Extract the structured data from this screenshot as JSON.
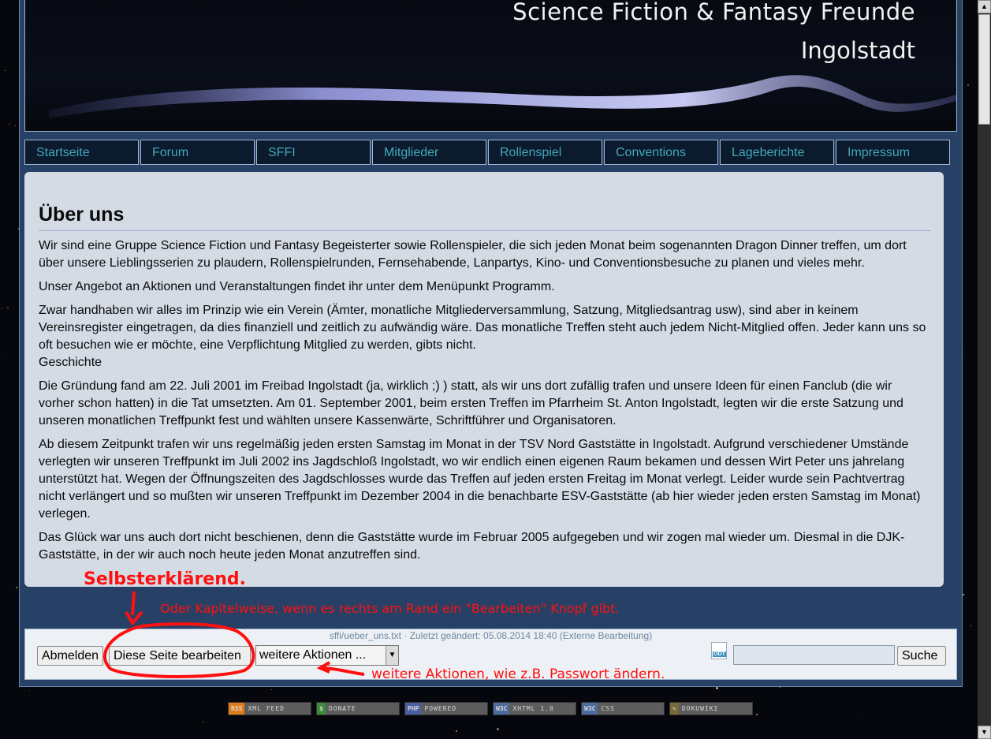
{
  "header": {
    "title_line1": "Science Fiction & Fantasy Freunde",
    "title_line2": "Ingolstadt"
  },
  "nav": {
    "items": [
      "Startseite",
      "Forum",
      "SFFI",
      "Mitglieder",
      "Rollenspiel",
      "Conventions",
      "Lageberichte",
      "Impressum"
    ]
  },
  "content": {
    "title": "Über uns",
    "p1": "Wir sind eine Gruppe Science Fiction und Fantasy Begeisterter sowie Rollenspieler, die sich jeden Monat beim sogenannten Dragon Dinner treffen, um dort über unsere Lieblingsserien zu plaudern, Rollenspielrunden, Fernsehabende, Lanpartys, Kino- und Conventionsbesuche zu planen und vieles mehr.",
    "p2": "Unser Angebot an Aktionen und Veranstaltungen findet ihr unter dem Menüpunkt Programm.",
    "p3": "Zwar handhaben wir alles im Prinzip wie ein Verein (Ämter, monatliche Mitgliederversammlung, Satzung, Mitgliedsantrag usw), sind aber in keinem Vereinsregister eingetragen, da dies finanziell und zeitlich zu aufwändig wäre. Das monatliche Treffen steht auch jedem Nicht-Mitglied offen. Jeder kann uns so oft besuchen wie er möchte, eine Verpflichtung Mitglied zu werden, gibts nicht.",
    "heading2": "Geschichte",
    "p4": "Die Gründung fand am 22. Juli 2001 im Freibad Ingolstadt (ja, wirklich ;) ) statt, als wir uns dort zufällig trafen und unsere Ideen für einen Fanclub (die wir vorher schon hatten) in die Tat umsetzten. Am 01. September 2001, beim ersten Treffen im Pfarrheim St. Anton Ingolstadt, legten wir die erste Satzung und unseren monatlichen Treffpunkt fest und wählten unsere Kassenwärte, Schriftführer und Organisatoren.",
    "p5": "Ab diesem Zeitpunkt trafen wir uns regelmäßig jeden ersten Samstag im Monat in der TSV Nord Gaststätte in Ingolstadt. Aufgrund verschiedener Umstände verlegten wir unseren Treffpunkt im Juli 2002 ins Jagdschloß Ingolstadt, wo wir endlich einen eigenen Raum bekamen und dessen Wirt Peter uns jahrelang unterstützt hat. Wegen der Öffnungszeiten des Jagdschlosses wurde das Treffen auf jeden ersten Freitag im Monat verlegt. Leider wurde sein Pachtvertrag nicht verlängert und so mußten wir unseren Treffpunkt im Dezember 2004 in die benachbarte ESV-Gaststätte (ab hier wieder jeden ersten Samstag im Monat) verlegen.",
    "p6": "Das Glück war uns auch dort nicht beschienen, denn die Gaststätte wurde im Februar 2005 aufgegeben und wir zogen mal wieder um. Diesmal in die DJK-Gaststätte, in der wir auch noch heute jeden Monat anzutreffen sind."
  },
  "footer": {
    "pageinfo": "sffi/ueber_uns.txt · Zuletzt geändert: 05.08.2014 18:40 (Externe Bearbeitung)",
    "logout_label": "Abmelden",
    "edit_label": "Diese Seite bearbeiten",
    "actions_select": "weitere Aktionen ...",
    "odt_label": "ODT",
    "search_value": "",
    "search_label": "Suche"
  },
  "annotations": {
    "big": "Selbsterklärend.",
    "mid": "Oder Kapitelweise, wenn es rechts am Rand ein \"Bearbeiten\" Knopf gibt.",
    "right": "weitere Aktionen, wie z.B. Passwort ändern."
  },
  "badges": [
    {
      "left": "RSS",
      "right": "XML FEED",
      "color": "#e07b1a"
    },
    {
      "left": "$",
      "right": "DONATE",
      "color": "#3c8a3c"
    },
    {
      "left": "PHP",
      "right": "POWERED",
      "color": "#4a5fa0"
    },
    {
      "left": "W3C",
      "right": "XHTML 1.0",
      "color": "#4c6c9c"
    },
    {
      "left": "W3C",
      "right": "CSS",
      "color": "#4c6c9c"
    },
    {
      "left": "✎",
      "right": "DOKUWIKI",
      "color": "#7a6a3a"
    }
  ],
  "colors": {
    "accent_link": "#43a9bc",
    "annotation": "#ff1010",
    "frame": "#274065"
  }
}
